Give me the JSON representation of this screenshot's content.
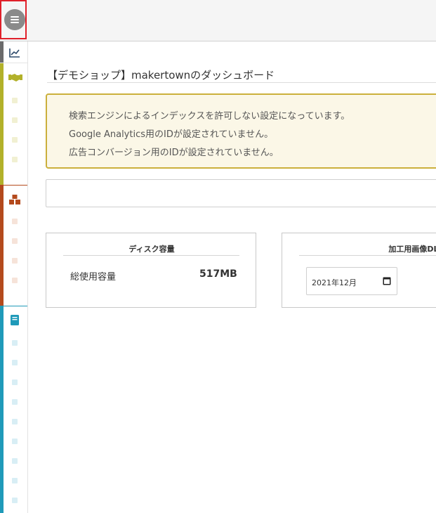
{
  "header": {
    "menu_icon": "hamburger-menu-icon"
  },
  "sidebar": {
    "colors": {
      "gray": "#6b6b6b",
      "olive": "#b2b12a",
      "rust": "#b44a1d",
      "teal": "#1f9ab9"
    },
    "icons": [
      "chart-line-icon",
      "handshake-icon",
      "boxes-icon",
      "book-icon"
    ]
  },
  "main": {
    "title": "【デモショップ】makertownのダッシュボード",
    "alerts": [
      "検索エンジンによるインデックスを許可しない設定になっています。",
      "Google Analytics用のIDが設定されていません。",
      "広告コンバージョン用のIDが設定されていません。"
    ],
    "disk_card": {
      "title": "ディスク容量",
      "label": "総使用容量",
      "value": "517MB"
    },
    "dl_card": {
      "title": "加工用画像DL数",
      "date_value": "2021年12月"
    }
  }
}
